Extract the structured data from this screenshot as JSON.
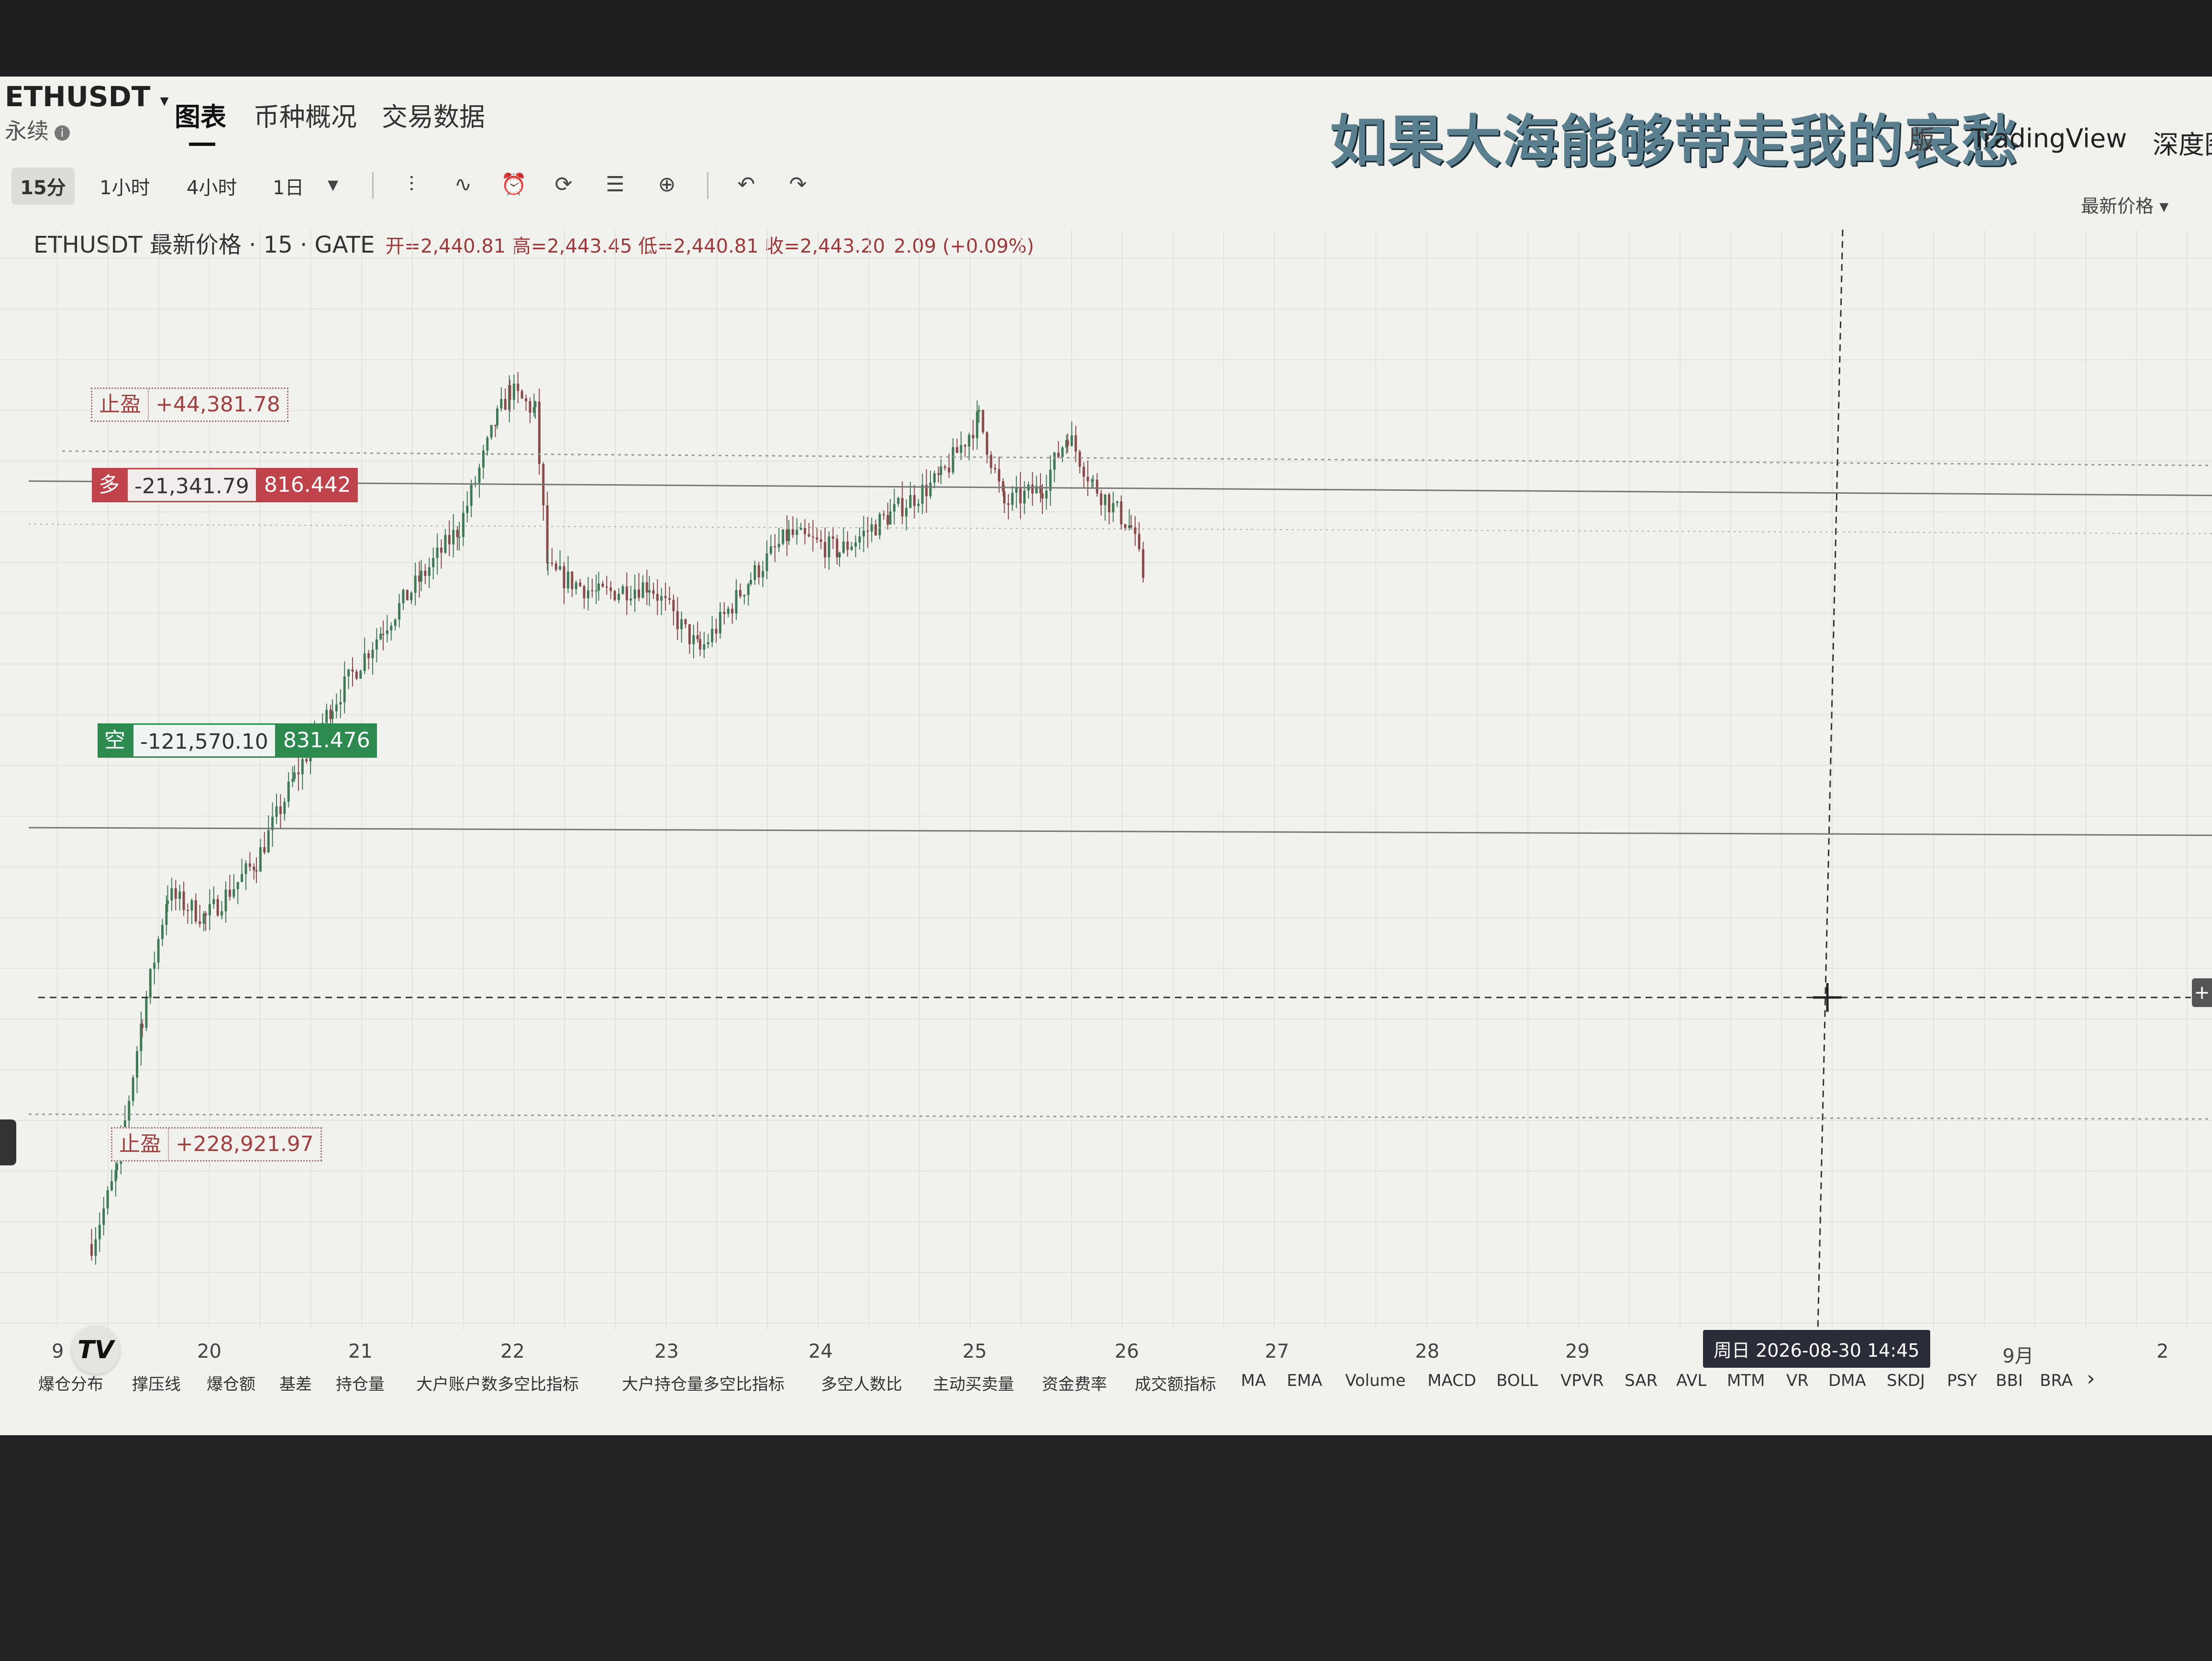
{
  "header": {
    "symbol": "ETHUSDT",
    "dropdown_glyph": "▾",
    "contract_type": "永续",
    "info_glyph": "i",
    "nav": [
      "图表",
      "币种概况",
      "交易数据"
    ],
    "watermark": "如果大海能够带走我的哀愁",
    "watermark_tail": "版",
    "tradingview": "TradingView",
    "depth": "深度图"
  },
  "toolbar": {
    "timeframes": [
      "15分",
      "1小时",
      "4小时",
      "1日"
    ],
    "dropdown_glyph": "▾",
    "icons": [
      "bar-style-icon",
      "indicators-icon",
      "alert-icon",
      "replay-icon",
      "templates-icon",
      "add-icon",
      "undo-icon",
      "redo-icon"
    ],
    "icon_glyphs": [
      "⫶",
      "∿",
      "⏰",
      "⟳",
      "☰",
      "⊕",
      "↶",
      "↷"
    ],
    "price_mode": "最新价格 ▾"
  },
  "legend": {
    "title": "ETHUSDT 最新价格 · 15 · GATE",
    "ohlc": "开=2,440.81  高=2,443.45  低=2,440.81  收=2,443.20",
    "change": "2.09 (+0.09%)"
  },
  "positions": {
    "tp_upper": {
      "label": "止盈",
      "value": "+44,381.78"
    },
    "long": {
      "side": "多",
      "pnl": "-21,341.79",
      "qty": "816.442"
    },
    "short": {
      "side": "空",
      "pnl": "-121,570.10",
      "qty": "831.476"
    },
    "tp_lower": {
      "label": "止盈",
      "value": "+228,921.97"
    }
  },
  "xaxis": {
    "ticks": [
      "9",
      "20",
      "21",
      "22",
      "23",
      "24",
      "25",
      "26",
      "27",
      "28",
      "29",
      "9月",
      "2"
    ],
    "cursor_label": "周日 2026-08-30   14:45"
  },
  "indicators": [
    "爆仓分布",
    "撑压线",
    "爆仓额",
    "基差",
    "持仓量",
    "大户账户数多空比指标",
    "大户持仓量多空比指标",
    "多空人数比",
    "主动买卖量",
    "资金费率",
    "成交额指标",
    "MA",
    "EMA",
    "Volume",
    "MACD",
    "BOLL",
    "VPVR",
    "SAR",
    "AVL",
    "MTM",
    "VR",
    "DMA",
    "SKDJ",
    "PSY",
    "BBI",
    "BRA"
  ],
  "indicator_more": "›",
  "tv_logo": "TV",
  "right_handle": "+",
  "chart_data": {
    "type": "candlestick",
    "price_path": [
      {
        "t": "19 06:00",
        "p": 2300
      },
      {
        "t": "19 10:00",
        "p": 2322
      },
      {
        "t": "19 14:00",
        "p": 2368
      },
      {
        "t": "19 18:00",
        "p": 2405
      },
      {
        "t": "20 00:00",
        "p": 2398
      },
      {
        "t": "20 08:00",
        "p": 2415
      },
      {
        "t": "20 14:00",
        "p": 2440
      },
      {
        "t": "20 20:00",
        "p": 2462
      },
      {
        "t": "21 04:00",
        "p": 2485
      },
      {
        "t": "21 10:00",
        "p": 2500
      },
      {
        "t": "21 16:00",
        "p": 2515
      },
      {
        "t": "21 22:00",
        "p": 2548
      },
      {
        "t": "22 00:00",
        "p": 2556
      },
      {
        "t": "22 04:00",
        "p": 2550
      },
      {
        "t": "22 06:00",
        "p": 2502
      },
      {
        "t": "22 14:00",
        "p": 2495
      },
      {
        "t": "22 22:00",
        "p": 2498
      },
      {
        "t": "23 06:00",
        "p": 2478
      },
      {
        "t": "23 14:00",
        "p": 2500
      },
      {
        "t": "23 20:00",
        "p": 2513
      },
      {
        "t": "24 04:00",
        "p": 2508
      },
      {
        "t": "24 12:00",
        "p": 2519
      },
      {
        "t": "24 20:00",
        "p": 2530
      },
      {
        "t": "25 02:00",
        "p": 2548
      },
      {
        "t": "25 06:00",
        "p": 2522
      },
      {
        "t": "25 12:00",
        "p": 2527
      },
      {
        "t": "25 16:00",
        "p": 2543
      },
      {
        "t": "25 20:00",
        "p": 2528
      },
      {
        "t": "26 02:00",
        "p": 2515
      },
      {
        "t": "26 04:00",
        "p": 2500
      }
    ],
    "last_close": 2443.2,
    "levels": {
      "long_entry": 2529,
      "short_entry": 2425,
      "tp_upper": 2538,
      "tp_lower": 2339,
      "crosshair": 2380
    }
  },
  "colors": {
    "up": "#3f7a56",
    "down": "#8a4a4a",
    "grid": "#e2e2de",
    "long": "#c0434b",
    "short": "#2e8b4f"
  }
}
